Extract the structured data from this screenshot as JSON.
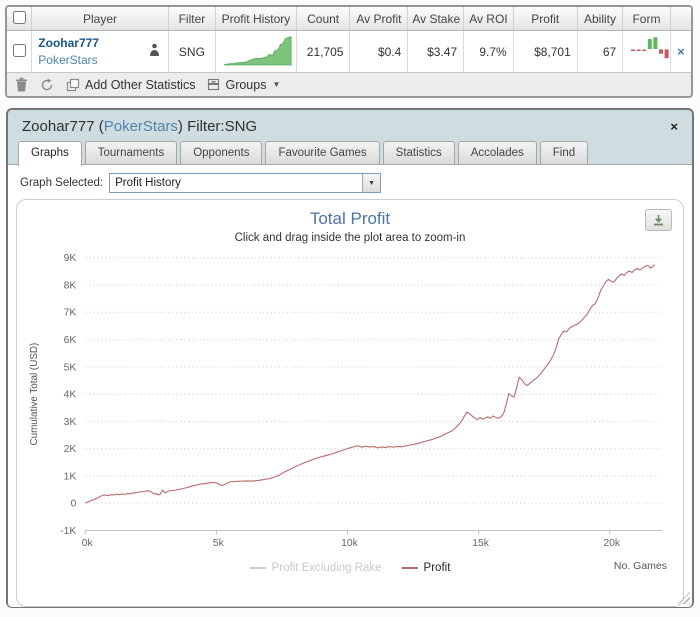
{
  "colors": {
    "accent_blue": "#4a74a5",
    "link_dark_blue": "#17568e",
    "link_blue": "#4f84ad",
    "profit_line": "#b96a6e",
    "sparkline_green": "#7cc47c",
    "sparkline_green_edge": "#58a958",
    "form_green": "#5cb85c",
    "form_red": "#bf5b5b",
    "disabled_legend": "#cccccc",
    "popup_header_bg": "#cfdce0"
  },
  "table": {
    "headers": [
      "Player",
      "Filter",
      "Profit History",
      "Count",
      "Av Profit",
      "Av Stake",
      "Av ROI",
      "Profit",
      "Ability",
      "Form"
    ],
    "row": {
      "player_name": "Zoohar777",
      "site": "PokerStars",
      "filter": "SNG",
      "count": "21,705",
      "av_profit": "$0.4",
      "av_stake": "$3.47",
      "av_roi": "9.7%",
      "profit": "$8,701",
      "ability": "67",
      "remove_label": "×"
    },
    "form_bars": [
      -0.25,
      -0.25,
      -0.25,
      2.6,
      3.1,
      -1.1,
      -2.3
    ],
    "toolbar": {
      "add_other_statistics_label": "Add Other Statistics",
      "groups_label": "Groups",
      "groups_caret": "▼"
    }
  },
  "popup": {
    "title_prefix": "Zoohar777 (",
    "title_site": "PokerStars",
    "title_suffix": ") Filter:SNG",
    "close_glyph": "×",
    "tabs": [
      "Graphs",
      "Tournaments",
      "Opponents",
      "Favourite Games",
      "Statistics",
      "Accolades",
      "Find"
    ],
    "active_tab": "Graphs",
    "graph_selected_label": "Graph Selected:",
    "graph_selected_value": "Profit History"
  },
  "chart_data": {
    "type": "line",
    "title": "Total Profit",
    "subtitle": "Click and drag inside the plot area to zoom-in",
    "ylabel": "Cumulative Total (USD)",
    "xlabel": "No. Games",
    "xlim": [
      0,
      22000
    ],
    "ylim": [
      -1000,
      9000
    ],
    "grid": "horizontal-dotted",
    "legend_position": "bottom-center",
    "final_value": 8701,
    "total_games": 21705,
    "yticks": [
      {
        "v": 9000,
        "label": "9K"
      },
      {
        "v": 8000,
        "label": "8K"
      },
      {
        "v": 7000,
        "label": "7K"
      },
      {
        "v": 6000,
        "label": "6K"
      },
      {
        "v": 5000,
        "label": "5K"
      },
      {
        "v": 4000,
        "label": "4K"
      },
      {
        "v": 3000,
        "label": "3K"
      },
      {
        "v": 2000,
        "label": "2K"
      },
      {
        "v": 1000,
        "label": "1K"
      },
      {
        "v": 0,
        "label": "0"
      },
      {
        "v": -1000,
        "label": "-1K"
      }
    ],
    "xticks": [
      {
        "v": 0,
        "label": "0k"
      },
      {
        "v": 5000,
        "label": "5k"
      },
      {
        "v": 10000,
        "label": "10k"
      },
      {
        "v": 15000,
        "label": "15k"
      },
      {
        "v": 20000,
        "label": "20k"
      }
    ],
    "legend": [
      {
        "name": "Profit Excluding Rake",
        "color": "#cccccc",
        "enabled": false
      },
      {
        "name": "Profit",
        "color": "#b96a6e",
        "enabled": true
      }
    ],
    "series": [
      {
        "name": "Profit",
        "color": "#b96a6e",
        "points": [
          [
            0,
            0
          ],
          [
            150,
            60
          ],
          [
            300,
            120
          ],
          [
            450,
            180
          ],
          [
            600,
            260
          ],
          [
            700,
            300
          ],
          [
            800,
            295
          ],
          [
            900,
            280
          ],
          [
            1000,
            315
          ],
          [
            1100,
            300
          ],
          [
            1200,
            330
          ],
          [
            1300,
            310
          ],
          [
            1400,
            340
          ],
          [
            1500,
            320
          ],
          [
            1600,
            350
          ],
          [
            1700,
            345
          ],
          [
            1800,
            365
          ],
          [
            1900,
            380
          ],
          [
            2000,
            395
          ],
          [
            2100,
            415
          ],
          [
            2200,
            425
          ],
          [
            2300,
            440
          ],
          [
            2400,
            455
          ],
          [
            2500,
            430
          ],
          [
            2600,
            340
          ],
          [
            2700,
            350
          ],
          [
            2750,
            310
          ],
          [
            2850,
            320
          ],
          [
            2950,
            480
          ],
          [
            3000,
            420
          ],
          [
            3050,
            380
          ],
          [
            3150,
            430
          ],
          [
            3250,
            455
          ],
          [
            3350,
            465
          ],
          [
            3450,
            480
          ],
          [
            3550,
            500
          ],
          [
            3700,
            530
          ],
          [
            3850,
            565
          ],
          [
            4000,
            605
          ],
          [
            4150,
            645
          ],
          [
            4300,
            680
          ],
          [
            4450,
            705
          ],
          [
            4600,
            725
          ],
          [
            4750,
            745
          ],
          [
            4900,
            760
          ],
          [
            5000,
            745
          ],
          [
            5100,
            700
          ],
          [
            5200,
            650
          ],
          [
            5300,
            680
          ],
          [
            5400,
            730
          ],
          [
            5500,
            775
          ],
          [
            5600,
            790
          ],
          [
            5700,
            795
          ],
          [
            5800,
            800
          ],
          [
            6000,
            810
          ],
          [
            6200,
            815
          ],
          [
            6400,
            810
          ],
          [
            6600,
            835
          ],
          [
            6800,
            865
          ],
          [
            7000,
            895
          ],
          [
            7200,
            950
          ],
          [
            7400,
            1030
          ],
          [
            7600,
            1140
          ],
          [
            7800,
            1240
          ],
          [
            8000,
            1330
          ],
          [
            8200,
            1420
          ],
          [
            8400,
            1500
          ],
          [
            8600,
            1570
          ],
          [
            8800,
            1650
          ],
          [
            9000,
            1700
          ],
          [
            9200,
            1750
          ],
          [
            9400,
            1805
          ],
          [
            9600,
            1870
          ],
          [
            9800,
            1935
          ],
          [
            10000,
            2000
          ],
          [
            10200,
            2060
          ],
          [
            10400,
            2105
          ],
          [
            10550,
            2050
          ],
          [
            10700,
            2090
          ],
          [
            10850,
            2060
          ],
          [
            11000,
            2075
          ],
          [
            11150,
            2030
          ],
          [
            11300,
            2060
          ],
          [
            11450,
            2040
          ],
          [
            11600,
            2075
          ],
          [
            11750,
            2050
          ],
          [
            11900,
            2080
          ],
          [
            12050,
            2065
          ],
          [
            12200,
            2095
          ],
          [
            12350,
            2125
          ],
          [
            12500,
            2150
          ],
          [
            12650,
            2180
          ],
          [
            12800,
            2225
          ],
          [
            12950,
            2260
          ],
          [
            13100,
            2300
          ],
          [
            13250,
            2345
          ],
          [
            13400,
            2400
          ],
          [
            13550,
            2445
          ],
          [
            13700,
            2520
          ],
          [
            13850,
            2590
          ],
          [
            14000,
            2660
          ],
          [
            14150,
            2790
          ],
          [
            14300,
            2940
          ],
          [
            14450,
            3180
          ],
          [
            14550,
            3340
          ],
          [
            14650,
            3280
          ],
          [
            14750,
            3200
          ],
          [
            14850,
            3120
          ],
          [
            14950,
            3060
          ],
          [
            15050,
            3140
          ],
          [
            15150,
            3080
          ],
          [
            15250,
            3120
          ],
          [
            15350,
            3170
          ],
          [
            15450,
            3110
          ],
          [
            15550,
            3200
          ],
          [
            15650,
            3150
          ],
          [
            15750,
            3110
          ],
          [
            15850,
            3170
          ],
          [
            15950,
            3280
          ],
          [
            16050,
            3620
          ],
          [
            16150,
            4020
          ],
          [
            16250,
            3940
          ],
          [
            16350,
            3890
          ],
          [
            16450,
            4240
          ],
          [
            16550,
            4620
          ],
          [
            16650,
            4520
          ],
          [
            16750,
            4380
          ],
          [
            16850,
            4310
          ],
          [
            16950,
            4390
          ],
          [
            17100,
            4510
          ],
          [
            17250,
            4620
          ],
          [
            17400,
            4790
          ],
          [
            17550,
            4980
          ],
          [
            17700,
            5180
          ],
          [
            17850,
            5420
          ],
          [
            17950,
            5680
          ],
          [
            18050,
            6020
          ],
          [
            18150,
            6180
          ],
          [
            18250,
            6320
          ],
          [
            18350,
            6280
          ],
          [
            18450,
            6400
          ],
          [
            18550,
            6470
          ],
          [
            18650,
            6520
          ],
          [
            18750,
            6560
          ],
          [
            18850,
            6630
          ],
          [
            18950,
            6720
          ],
          [
            19050,
            6830
          ],
          [
            19150,
            6940
          ],
          [
            19250,
            7120
          ],
          [
            19350,
            7260
          ],
          [
            19450,
            7320
          ],
          [
            19550,
            7520
          ],
          [
            19650,
            7790
          ],
          [
            19750,
            7960
          ],
          [
            19850,
            8120
          ],
          [
            19950,
            8210
          ],
          [
            20050,
            8140
          ],
          [
            20150,
            8100
          ],
          [
            20250,
            8220
          ],
          [
            20350,
            8330
          ],
          [
            20450,
            8410
          ],
          [
            20550,
            8350
          ],
          [
            20650,
            8460
          ],
          [
            20750,
            8510
          ],
          [
            20850,
            8460
          ],
          [
            20950,
            8560
          ],
          [
            21050,
            8610
          ],
          [
            21150,
            8550
          ],
          [
            21250,
            8620
          ],
          [
            21350,
            8680
          ],
          [
            21450,
            8720
          ],
          [
            21550,
            8620
          ],
          [
            21650,
            8680
          ],
          [
            21705,
            8750
          ]
        ]
      }
    ]
  }
}
